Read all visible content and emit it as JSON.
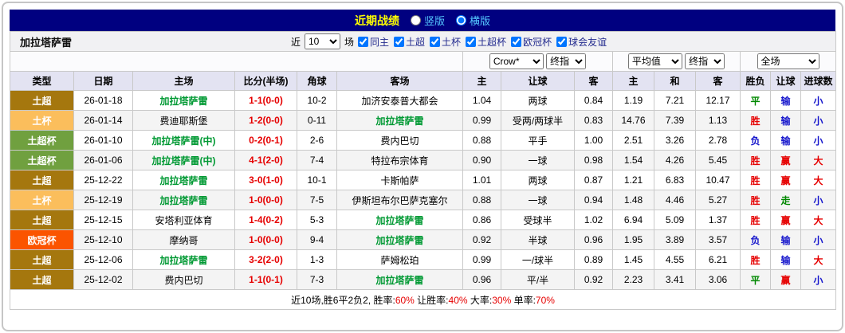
{
  "titlebar": {
    "title": "近期战绩",
    "vertical_label": "竖版",
    "horizontal_label": "横版",
    "selected_layout": "横版"
  },
  "filterbar": {
    "team": "加拉塔萨雷",
    "recent_label": "近",
    "recent_value": "10",
    "games_label": "场",
    "checkboxes": [
      {
        "label": "同主",
        "checked": true
      },
      {
        "label": "土超",
        "checked": true
      },
      {
        "label": "土杯",
        "checked": true
      },
      {
        "label": "土超杯",
        "checked": true
      },
      {
        "label": "欧冠杯",
        "checked": true
      },
      {
        "label": "球会友谊",
        "checked": true
      }
    ]
  },
  "selectors": {
    "bookmaker": "Crow*",
    "bookmaker_stage": "终指",
    "average": "平均值",
    "average_stage": "终指",
    "scope": "全场"
  },
  "colors": {
    "titlebar_bg": "#000080",
    "title_text": "#ffff00",
    "radio_label": "#55c8ff",
    "header_bg": "#e3e3f2",
    "team_focus": "#009933",
    "score": "#e60000"
  },
  "type_colors": {
    "土超": "#a5770e",
    "土杯": "#fbbe5c",
    "土超杯": "#70a03f",
    "欧冠杯": "#fb5400"
  },
  "result_colors": {
    "win": "#e60000",
    "lose": "#1616cc",
    "draw": "#008800"
  },
  "table": {
    "headers": [
      "类型",
      "日期",
      "主场",
      "比分(半场)",
      "角球",
      "客场",
      "主",
      "让球",
      "客",
      "主",
      "和",
      "客",
      "胜负",
      "让球",
      "进球数"
    ],
    "rows": [
      {
        "league": "土超",
        "date": "26-01-18",
        "home": "加拉塔萨雷",
        "home_focus": true,
        "score": "1-1(0-0)",
        "corners": "10-2",
        "away": "加济安泰普大都会",
        "away_focus": false,
        "odds": [
          "1.04",
          "两球",
          "0.84"
        ],
        "avg": [
          "1.19",
          "7.21",
          "12.17"
        ],
        "result": "平",
        "result_cls": "draw",
        "handicap": "输",
        "handicap_cls": "lose",
        "goals": "小",
        "goals_cls": "lose"
      },
      {
        "league": "土杯",
        "date": "26-01-14",
        "home": "费迪耶斯堡",
        "home_focus": false,
        "score": "1-2(0-0)",
        "corners": "0-11",
        "away": "加拉塔萨雷",
        "away_focus": true,
        "odds": [
          "0.99",
          "受两/两球半",
          "0.83"
        ],
        "avg": [
          "14.76",
          "7.39",
          "1.13"
        ],
        "result": "胜",
        "result_cls": "win",
        "handicap": "输",
        "handicap_cls": "lose",
        "goals": "小",
        "goals_cls": "lose"
      },
      {
        "league": "土超杯",
        "date": "26-01-10",
        "home": "加拉塔萨雷(中)",
        "home_focus": true,
        "score": "0-2(0-1)",
        "corners": "2-6",
        "away": "费内巴切",
        "away_focus": false,
        "odds": [
          "0.88",
          "平手",
          "1.00"
        ],
        "avg": [
          "2.51",
          "3.26",
          "2.78"
        ],
        "result": "负",
        "result_cls": "lose",
        "handicap": "输",
        "handicap_cls": "lose",
        "goals": "小",
        "goals_cls": "lose"
      },
      {
        "league": "土超杯",
        "date": "26-01-06",
        "home": "加拉塔萨雷(中)",
        "home_focus": true,
        "score": "4-1(2-0)",
        "corners": "7-4",
        "away": "特拉布宗体育",
        "away_focus": false,
        "odds": [
          "0.90",
          "一球",
          "0.98"
        ],
        "avg": [
          "1.54",
          "4.26",
          "5.45"
        ],
        "result": "胜",
        "result_cls": "win",
        "handicap": "赢",
        "handicap_cls": "win",
        "goals": "大",
        "goals_cls": "win"
      },
      {
        "league": "土超",
        "date": "25-12-22",
        "home": "加拉塔萨雷",
        "home_focus": true,
        "score": "3-0(1-0)",
        "corners": "10-1",
        "away": "卡斯帕萨",
        "away_focus": false,
        "odds": [
          "1.01",
          "两球",
          "0.87"
        ],
        "avg": [
          "1.21",
          "6.83",
          "10.47"
        ],
        "result": "胜",
        "result_cls": "win",
        "handicap": "赢",
        "handicap_cls": "win",
        "goals": "大",
        "goals_cls": "win"
      },
      {
        "league": "土杯",
        "date": "25-12-19",
        "home": "加拉塔萨雷",
        "home_focus": true,
        "score": "1-0(0-0)",
        "corners": "7-5",
        "away": "伊斯坦布尔巴萨克塞尔",
        "away_focus": false,
        "odds": [
          "0.88",
          "一球",
          "0.94"
        ],
        "avg": [
          "1.48",
          "4.46",
          "5.27"
        ],
        "result": "胜",
        "result_cls": "win",
        "handicap": "走",
        "handicap_cls": "draw",
        "goals": "小",
        "goals_cls": "lose"
      },
      {
        "league": "土超",
        "date": "25-12-15",
        "home": "安塔利亚体育",
        "home_focus": false,
        "score": "1-4(0-2)",
        "corners": "5-3",
        "away": "加拉塔萨雷",
        "away_focus": true,
        "odds": [
          "0.86",
          "受球半",
          "1.02"
        ],
        "avg": [
          "6.94",
          "5.09",
          "1.37"
        ],
        "result": "胜",
        "result_cls": "win",
        "handicap": "赢",
        "handicap_cls": "win",
        "goals": "大",
        "goals_cls": "win"
      },
      {
        "league": "欧冠杯",
        "date": "25-12-10",
        "home": "摩纳哥",
        "home_focus": false,
        "score": "1-0(0-0)",
        "corners": "9-4",
        "away": "加拉塔萨雷",
        "away_focus": true,
        "odds": [
          "0.92",
          "半球",
          "0.96"
        ],
        "avg": [
          "1.95",
          "3.89",
          "3.57"
        ],
        "result": "负",
        "result_cls": "lose",
        "handicap": "输",
        "handicap_cls": "lose",
        "goals": "小",
        "goals_cls": "lose"
      },
      {
        "league": "土超",
        "date": "25-12-06",
        "home": "加拉塔萨雷",
        "home_focus": true,
        "score": "3-2(2-0)",
        "corners": "1-3",
        "away": "萨姆松珀",
        "away_focus": false,
        "odds": [
          "0.99",
          "一/球半",
          "0.89"
        ],
        "avg": [
          "1.45",
          "4.55",
          "6.21"
        ],
        "result": "胜",
        "result_cls": "win",
        "handicap": "输",
        "handicap_cls": "lose",
        "goals": "大",
        "goals_cls": "win"
      },
      {
        "league": "土超",
        "date": "25-12-02",
        "home": "费内巴切",
        "home_focus": false,
        "score": "1-1(0-1)",
        "corners": "7-3",
        "away": "加拉塔萨雷",
        "away_focus": true,
        "odds": [
          "0.96",
          "平/半",
          "0.92"
        ],
        "avg": [
          "2.23",
          "3.41",
          "3.06"
        ],
        "result": "平",
        "result_cls": "draw",
        "handicap": "赢",
        "handicap_cls": "win",
        "goals": "小",
        "goals_cls": "lose"
      }
    ]
  },
  "summary": {
    "parts": [
      {
        "text": "近10场,胜6平2负2, 胜率:",
        "red": false
      },
      {
        "text": "60%",
        "red": true
      },
      {
        "text": " 让胜率:",
        "red": false
      },
      {
        "text": "40%",
        "red": true
      },
      {
        "text": " 大率:",
        "red": false
      },
      {
        "text": "30%",
        "red": true
      },
      {
        "text": " 单率:",
        "red": false
      },
      {
        "text": "70%",
        "red": true
      }
    ]
  }
}
